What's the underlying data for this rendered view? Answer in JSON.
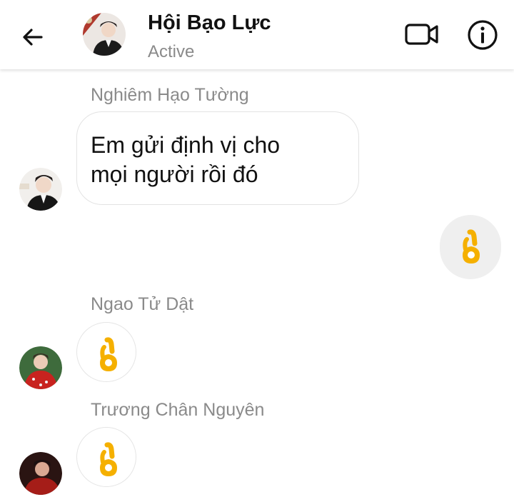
{
  "header": {
    "title": "Hội Bạo Lực",
    "status": "Active",
    "icons": [
      "back-arrow-icon",
      "video-call-icon",
      "info-icon"
    ]
  },
  "messages": [
    {
      "sender": "Nghiêm Hạo Tường",
      "text": "Em gửi định vị cho\nmọi người rồi đó"
    },
    {
      "sender": "me",
      "emoji": "ok-hand-icon"
    },
    {
      "sender": "Ngao Tử Dật",
      "emoji": "ok-hand-icon"
    },
    {
      "sender": "Trương Chân Nguyên",
      "emoji": "ok-hand-icon"
    }
  ],
  "colors": {
    "emoji": "#f7b500",
    "muted_text": "#8a8a8a",
    "sent_bubble": "#efefef"
  }
}
